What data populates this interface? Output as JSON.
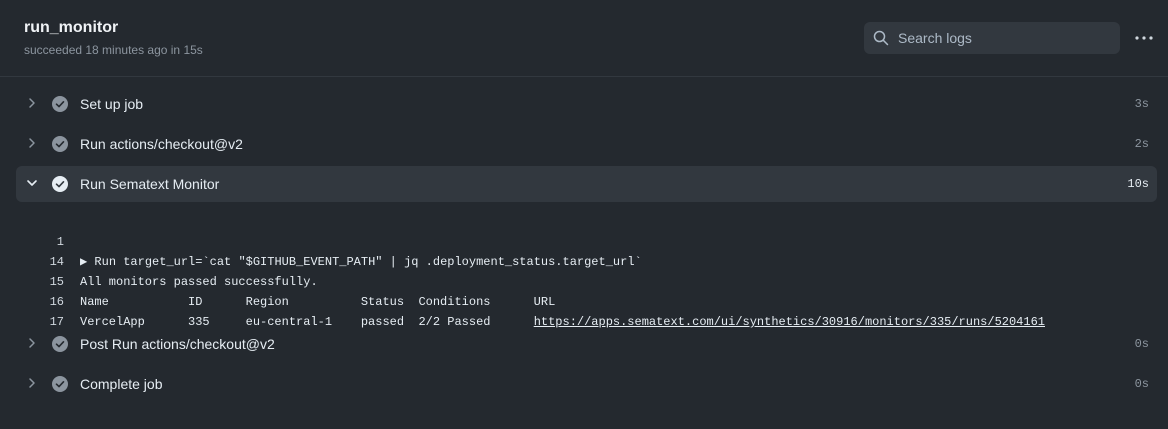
{
  "job": {
    "title": "run_monitor",
    "subtitle": "succeeded 18 minutes ago in 15s"
  },
  "search": {
    "placeholder": "Search logs"
  },
  "steps": [
    {
      "name": "Set up job",
      "duration": "3s",
      "expanded": false
    },
    {
      "name": "Run actions/checkout@v2",
      "duration": "2s",
      "expanded": false
    },
    {
      "name": "Run Sematext Monitor",
      "duration": "10s",
      "expanded": true
    },
    {
      "name": "Post Run actions/checkout@v2",
      "duration": "0s",
      "expanded": false
    },
    {
      "name": "Complete job",
      "duration": "0s",
      "expanded": false
    }
  ],
  "log": {
    "lines": [
      {
        "num": "1",
        "text": "▶ Run target_url=`cat \"$GITHUB_EVENT_PATH\" | jq .deployment_status.target_url`"
      },
      {
        "num": "14",
        "text": "All monitors passed successfully."
      },
      {
        "num": "15",
        "text": "Name           ID      Region          Status  Conditions      URL"
      },
      {
        "num": "16",
        "text": "VercelApp      335     eu-central-1    passed  2/2 Passed      ",
        "link": "https://apps.sematext.com/ui/synthetics/30916/monitors/335/runs/5204161"
      },
      {
        "num": "17",
        "text": ""
      }
    ]
  },
  "colors": {
    "background": "#24292f",
    "check_icon": "#8c959f",
    "expanded_row": "#32383f"
  },
  "icons": {
    "search": "search-icon",
    "more": "kebab-horizontal-icon",
    "chevron_collapsed": "chevron-right-icon",
    "chevron_expanded": "chevron-down-icon",
    "status": "check-circle-icon"
  }
}
